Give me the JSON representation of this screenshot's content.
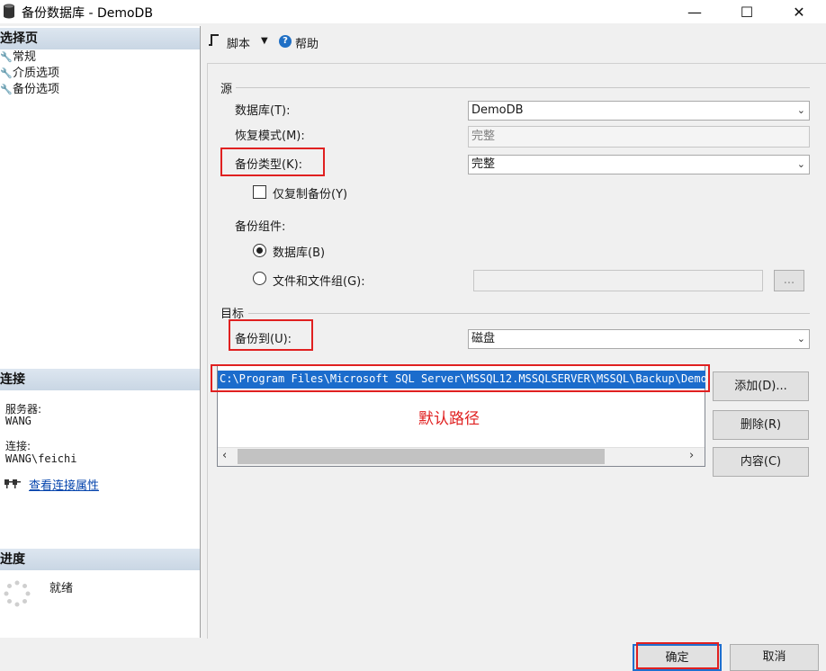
{
  "window": {
    "title": "备份数据库 - DemoDB",
    "minimize_icon": "—",
    "maximize_icon": "☐",
    "close_icon": "✕"
  },
  "left": {
    "select_page_header": "选择页",
    "pages": [
      {
        "label": "常规",
        "icon": "wrench-icon"
      },
      {
        "label": "介质选项",
        "icon": "wrench-icon"
      },
      {
        "label": "备份选项",
        "icon": "wrench-icon"
      }
    ],
    "connection_header": "连接",
    "server_label": "服务器:",
    "server_value": "WANG",
    "connection_label": "连接:",
    "connection_value": "WANG\\feichi",
    "view_connection_props": "查看连接属性",
    "progress_header": "进度",
    "status": "就绪"
  },
  "toolbar": {
    "script_label": "脚本",
    "help_label": "帮助"
  },
  "source": {
    "group_label": "源",
    "database_label": "数据库(T):",
    "database_value": "DemoDB",
    "recovery_label": "恢复模式(M):",
    "recovery_value": "完整",
    "backup_type_label": "备份类型(K):",
    "backup_type_value": "完整",
    "copy_only_label": "仅复制备份(Y)",
    "copy_only_checked": false,
    "component_label": "备份组件:",
    "component_db_label": "数据库(B)",
    "component_files_label": "文件和文件组(G):",
    "files_browse_label": "...",
    "files_value": ""
  },
  "destination": {
    "group_label": "目标",
    "backup_to_label": "备份到(U):",
    "backup_to_value": "磁盘",
    "path": "C:\\Program Files\\Microsoft SQL Server\\MSSQL12.MSSQLSERVER\\MSSQL\\Backup\\DemoDB.bak",
    "annotation": "默认路径",
    "add_button": "添加(D)...",
    "remove_button": "删除(R)",
    "contents_button": "内容(C)"
  },
  "footer": {
    "ok_button": "确定",
    "cancel_button": "取消"
  },
  "colors": {
    "highlight_red": "#e02020",
    "selection_blue": "#1b6ccc",
    "link_blue": "#0645ad"
  }
}
